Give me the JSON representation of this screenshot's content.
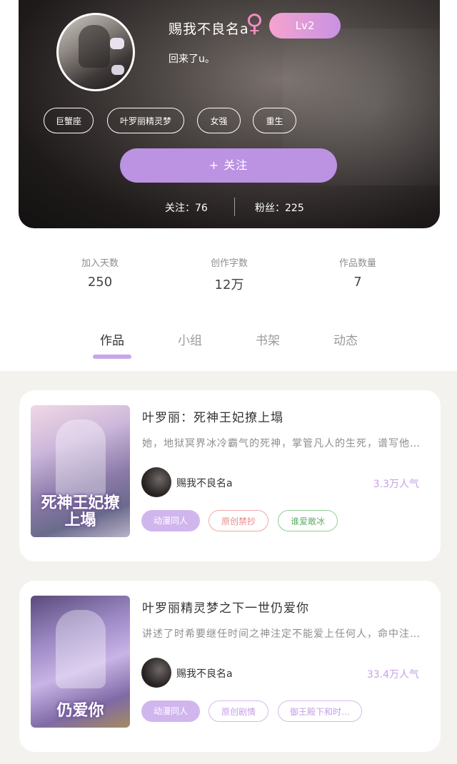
{
  "profile": {
    "name": "赐我不良名a",
    "gender_icon": "female-symbol",
    "level": "Lv2",
    "bio": "回来了u。",
    "tags": [
      "巨蟹座",
      "叶罗丽精灵梦",
      "女强",
      "重生"
    ],
    "follow_button": "+ 关注",
    "following_label": "关注：76",
    "followers_label": "粉丝：225"
  },
  "stats": [
    {
      "label": "加入天数",
      "value": "250"
    },
    {
      "label": "创作字数",
      "value": "12万"
    },
    {
      "label": "作品数量",
      "value": "7"
    }
  ],
  "tabs": [
    "作品",
    "小组",
    "书架",
    "动态"
  ],
  "active_tab": "作品",
  "works": [
    {
      "cover_text": "死神王妃撩上塌",
      "title": "叶罗丽：死神王妃撩上塌",
      "description": "她，地狱冥界冰冷霸气的死神，掌管凡人的生死，谱写他…",
      "author": "赐我不良名a",
      "popularity": "3.3万人气",
      "tags": [
        "动漫同人",
        "原创禁抄",
        "谁爱敢冰"
      ]
    },
    {
      "cover_text": "仍爱你",
      "title": "叶罗丽精灵梦之下一世仍爱你",
      "description": "讲述了时希要继任时间之神注定不能爱上任何人，命中注…",
      "author": "赐我不良名a",
      "popularity": "33.4万人气",
      "tags": [
        "动漫同人",
        "原创剧情",
        "御王殿下和时…"
      ]
    }
  ],
  "colors": {
    "accent": "#bc92e3",
    "tab_indicator": "#c9a6ea",
    "popularity": "#c5a1e8",
    "gender": "#f28bc4"
  }
}
